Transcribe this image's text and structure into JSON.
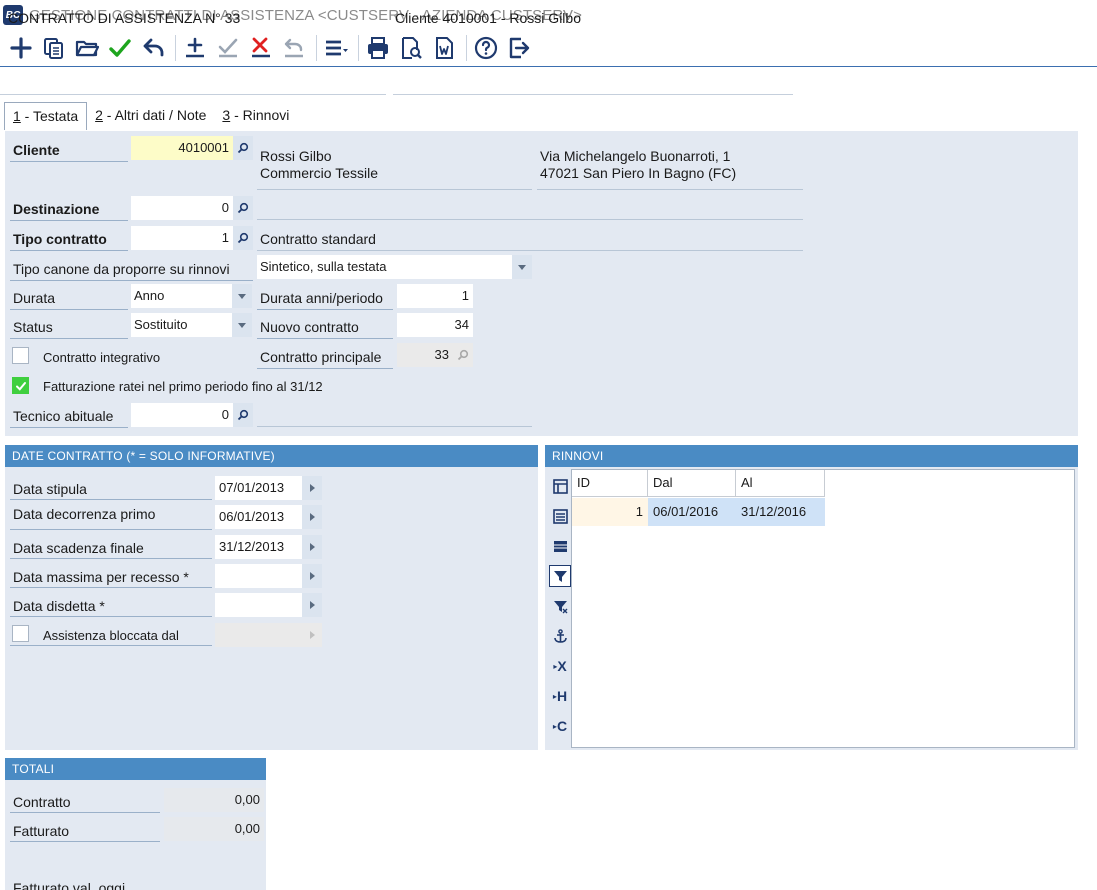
{
  "window": {
    "title": "GESTIONE CONTRATTI DI ASSISTENZA <CUSTSERV - AZIENDA CUSTSERV>",
    "logo_text": "BC"
  },
  "colors": {
    "accent": "#4a8bc4",
    "panel_bg": "#e3e9f2",
    "highlight_yellow": "#fdfcc8",
    "check_green": "#3fcf3f"
  },
  "toolbar": {
    "buttons": [
      "add-icon",
      "copy-icon",
      "open-folder-icon",
      "confirm-icon",
      "undo-icon",
      "add-row-icon",
      "confirm-row-icon",
      "delete-row-icon",
      "undo-row-icon",
      "menu-icon",
      "print-icon",
      "print-preview-icon",
      "word-icon",
      "help-icon",
      "exit-icon"
    ]
  },
  "header": {
    "contract_title": "CONTRATTO DI ASSISTENZA N° 33",
    "client_header": "Cliente 4010001 - Rossi Gilbo"
  },
  "tabs": [
    {
      "key": "1",
      "label": " - Testata"
    },
    {
      "key": "2",
      "label": " - Altri dati / Note"
    },
    {
      "key": "3",
      "label": " - Rinnovi"
    }
  ],
  "main": {
    "cliente": {
      "label": "Cliente",
      "code": "4010001",
      "name_line1": "Rossi Gilbo",
      "name_line2": "Commercio Tessile",
      "addr_line1": "Via Michelangelo Buonarroti, 1",
      "addr_line2": "47021 San Piero In Bagno (FC)"
    },
    "destinazione": {
      "label": "Destinazione",
      "code": "0"
    },
    "tipo_contratto": {
      "label": "Tipo contratto",
      "code": "1",
      "description": "Contratto standard"
    },
    "tipo_canone": {
      "label": "Tipo canone da proporre su rinnovi",
      "value": "Sintetico, sulla testata"
    },
    "durata": {
      "label": "Durata",
      "value": "Anno"
    },
    "durata_anni": {
      "label": "Durata anni/periodo",
      "value": "1"
    },
    "status": {
      "label": "Status",
      "value": "Sostituito"
    },
    "nuovo_contratto": {
      "label": "Nuovo contratto",
      "value": "34"
    },
    "contratto_integrativo": {
      "label": "Contratto integrativo",
      "checked": false
    },
    "contratto_principale": {
      "label": "Contratto principale",
      "value": "33"
    },
    "fatturazione_ratei": {
      "label": "Fatturazione ratei nel primo periodo fino al 31/12",
      "checked": true
    },
    "tecnico_abituale": {
      "label": "Tecnico abituale",
      "code": "0"
    }
  },
  "date_contratto": {
    "title": "DATE CONTRATTO (* = SOLO INFORMATIVE)",
    "stipula": {
      "label": "Data stipula",
      "value": "07/01/2013"
    },
    "decorrenza": {
      "label": "Data decorrenza primo",
      "value": "06/01/2013"
    },
    "scadenza": {
      "label": "Data scadenza finale",
      "value": "31/12/2013"
    },
    "recesso": {
      "label": "Data massima per recesso *",
      "value": ""
    },
    "disdetta": {
      "label": "Data disdetta *",
      "value": ""
    },
    "bloccata": {
      "label": "Assistenza bloccata dal",
      "checked": false,
      "value": ""
    }
  },
  "rinnovi": {
    "title": "RINNOVI",
    "columns": [
      "ID",
      "Dal",
      "Al"
    ],
    "rows": [
      {
        "id": "1",
        "dal": "06/01/2016",
        "al": "31/12/2016"
      }
    ],
    "side_tools": [
      "grid-settings-icon",
      "list-icon",
      "table-icon",
      "filter-active-icon",
      "filter-icon",
      "anchor-icon",
      "export-x-icon",
      "export-h-icon",
      "export-c-icon"
    ],
    "side_letters": {
      "x": "X",
      "h": "H",
      "c": "C"
    }
  },
  "totali": {
    "title": "TOTALI",
    "contratto": {
      "label": "Contratto",
      "value": "0,00"
    },
    "fatturato": {
      "label": "Fatturato",
      "value": "0,00"
    },
    "fatturato_oggi": {
      "label": "Fatturato val. oggi"
    }
  }
}
